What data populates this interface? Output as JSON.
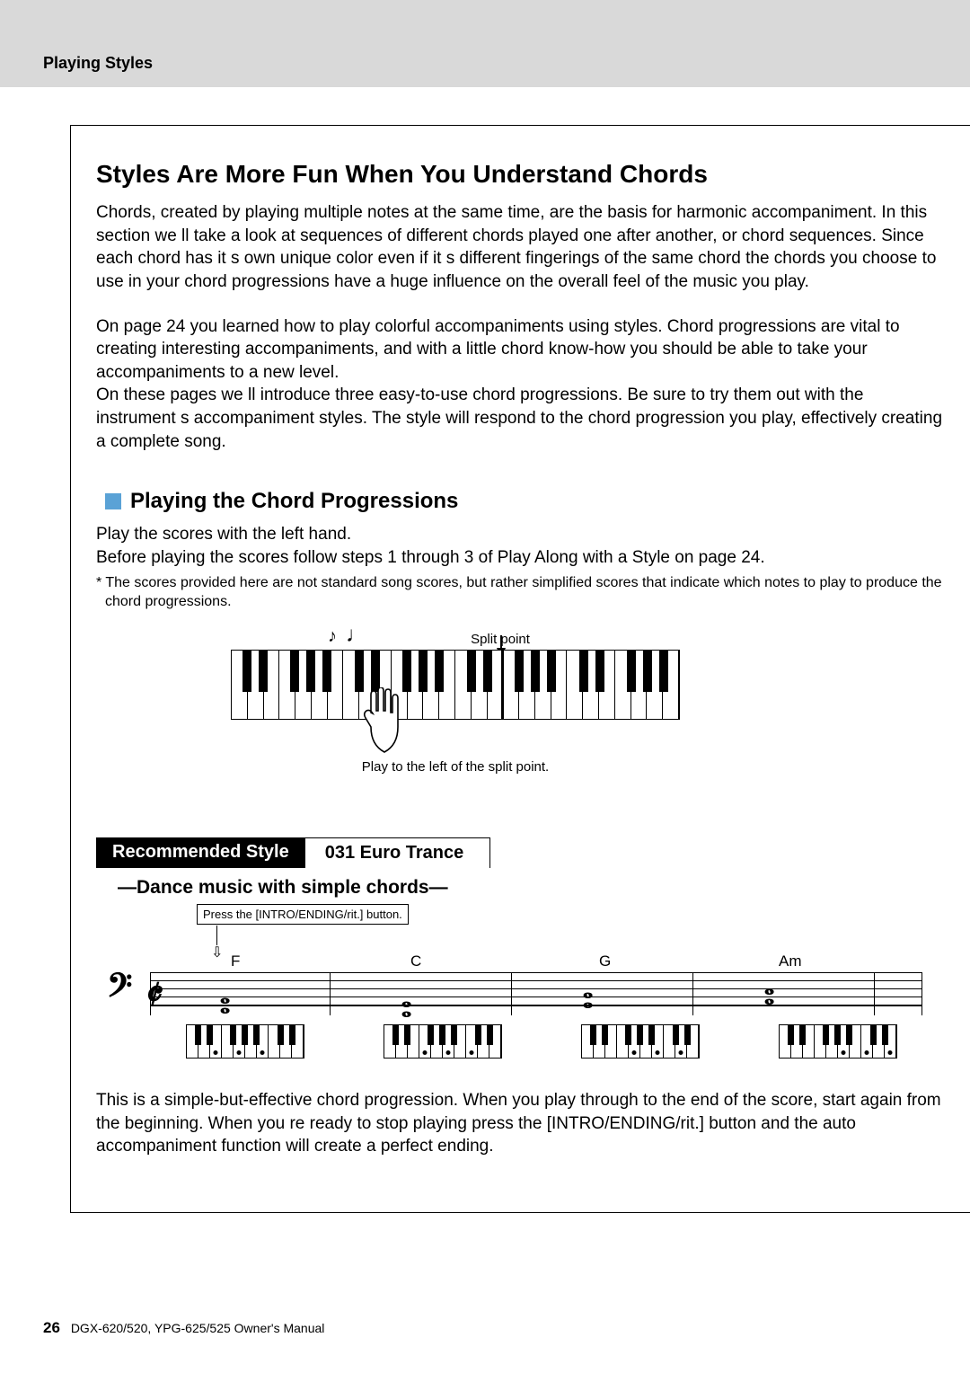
{
  "header": {
    "section_label": "Playing Styles"
  },
  "title": "Styles Are More Fun When You Understand Chords",
  "para1": "Chords, created by playing multiple notes at the same time, are the basis for harmonic accompaniment. In this section we ll take a look at sequences of different chords played one after another, or  chord sequences.  Since each chord has it s own unique  color  even if it s different ﬁngerings of the same chord the chords you choose to use in your chord progressions have a huge inﬂuence on the overall feel of the music you play.",
  "para2": "On page 24 you learned how to play colorful accompaniments using styles. Chord progressions are vital to creating interesting accompaniments, and with a little chord know-how you should be able to take your accompaniments to a new level.",
  "para3": "On these pages we ll introduce three easy-to-use chord progressions. Be sure to try them out with the instrument s accompaniment styles. The style will respond to the chord progression you play, effectively creating a complete song.",
  "subtitle": "Playing the Chord Progressions",
  "subpara1": "Play the scores with the left hand.",
  "subpara2": "Before playing the scores follow steps 1 through 3 of  Play Along with a Style  on page 24.",
  "fineprint": "* The scores provided here are not standard song scores, but rather simpliﬁed scores that indicate which notes to play to produce the chord progressions.",
  "keyboard": {
    "split_label": "Split point",
    "caption": "Play to the left of the split point."
  },
  "recommended": {
    "label": "Recommended Style",
    "value": "031 Euro Trance",
    "subtitle": "—Dance music with simple chords—"
  },
  "score": {
    "intro_box": "Press the [INTRO/ENDING/rit.] button.",
    "chords": [
      "F",
      "C",
      "G",
      "Am"
    ]
  },
  "closing": "This is a simple-but-effective chord progression. When you play through to the end of the score, start again from the beginning. When you re ready to stop playing press the [INTRO/ENDING/rit.] button and the auto accompaniment function will create a perfect ending.",
  "footer": {
    "page": "26",
    "manual": "DGX-620/520, YPG-625/525  Owner's Manual"
  }
}
